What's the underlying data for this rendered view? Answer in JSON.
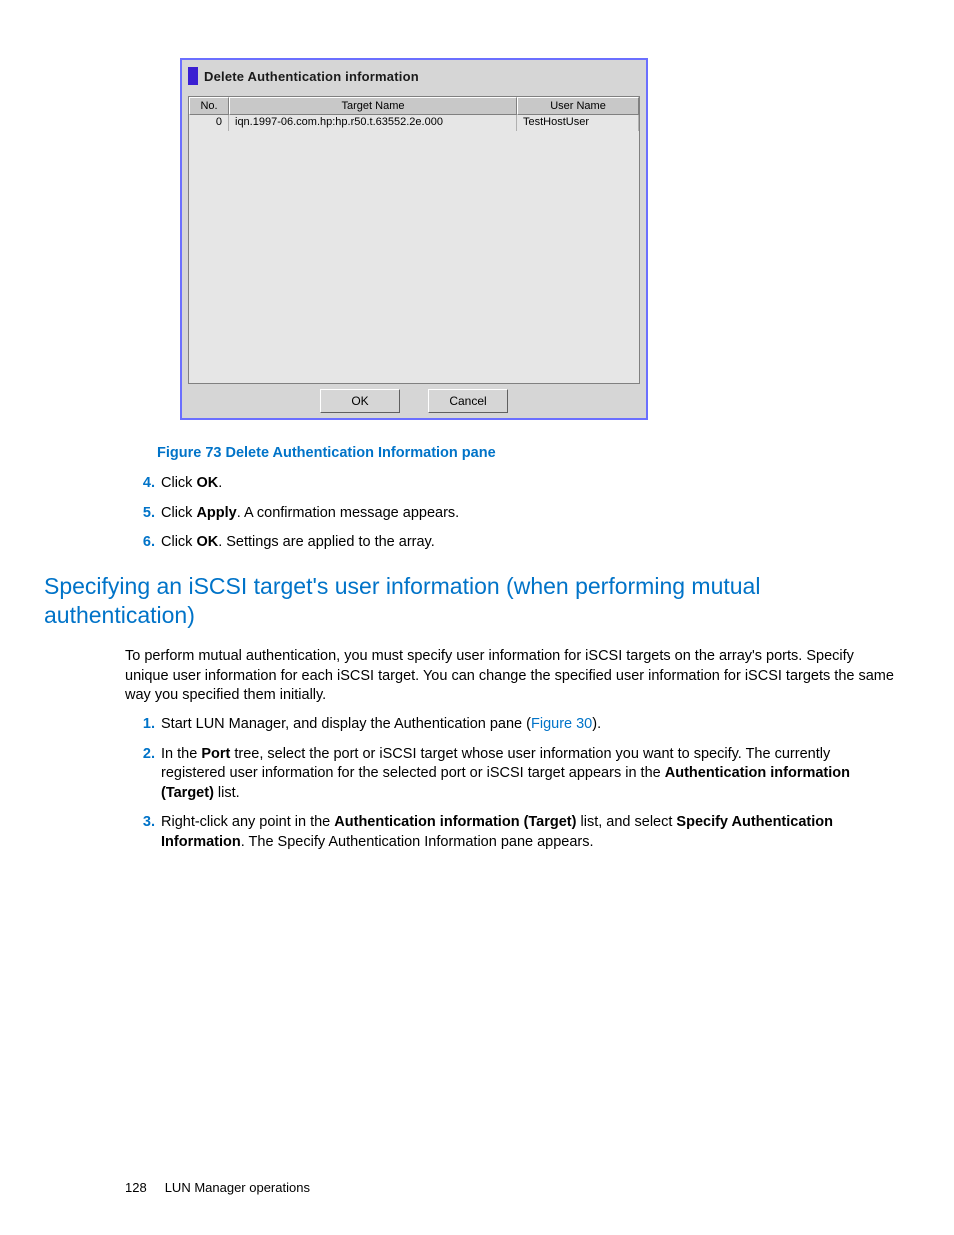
{
  "dialog": {
    "title": "Delete Authentication information",
    "columns": {
      "no": "No.",
      "target": "Target Name",
      "user": "User Name"
    },
    "rows": [
      {
        "no": "0",
        "target": "iqn.1997-06.com.hp:hp.r50.t.63552.2e.000",
        "user": "TestHostUser"
      }
    ],
    "ok": "OK",
    "cancel": "Cancel"
  },
  "figure": {
    "caption": "Figure 73 Delete Authentication Information pane"
  },
  "steps_a": {
    "s4_num": "4.",
    "s4_a": "Click ",
    "s4_b": "OK",
    "s4_c": ".",
    "s5_num": "5.",
    "s5_a": "Click ",
    "s5_b": "Apply",
    "s5_c": ".  A confirmation message appears.",
    "s6_num": "6.",
    "s6_a": "Click ",
    "s6_b": "OK",
    "s6_c": ". Settings are applied to the array."
  },
  "heading": "Specifying an iSCSI target's user information (when performing mutual authentication)",
  "paragraph": "To perform mutual authentication, you must specify user information for iSCSI targets on the array's ports. Specify unique user information for each iSCSI target. You can change the specified user information for iSCSI targets the same way you specified them initially.",
  "steps_b": {
    "s1_num": "1.",
    "s1_a": "Start LUN Manager, and display the Authentication pane (",
    "s1_link": "Figure 30",
    "s1_c": ").",
    "s2_num": "2.",
    "s2_a": "In the ",
    "s2_b": "Port",
    "s2_c": " tree, select the port or iSCSI target whose user information you want to specify. The currently registered user information for the selected port or iSCSI target appears in the ",
    "s2_d": "Authentication information (Target)",
    "s2_e": " list.",
    "s3_num": "3.",
    "s3_a": "Right-click any point in the ",
    "s3_b": "Authentication information (Target)",
    "s3_c": " list, and select ",
    "s3_d": "Specify Authentication Information",
    "s3_e": ".  The Specify Authentication Information pane appears."
  },
  "footer": {
    "page": "128",
    "section": "LUN Manager operations"
  }
}
